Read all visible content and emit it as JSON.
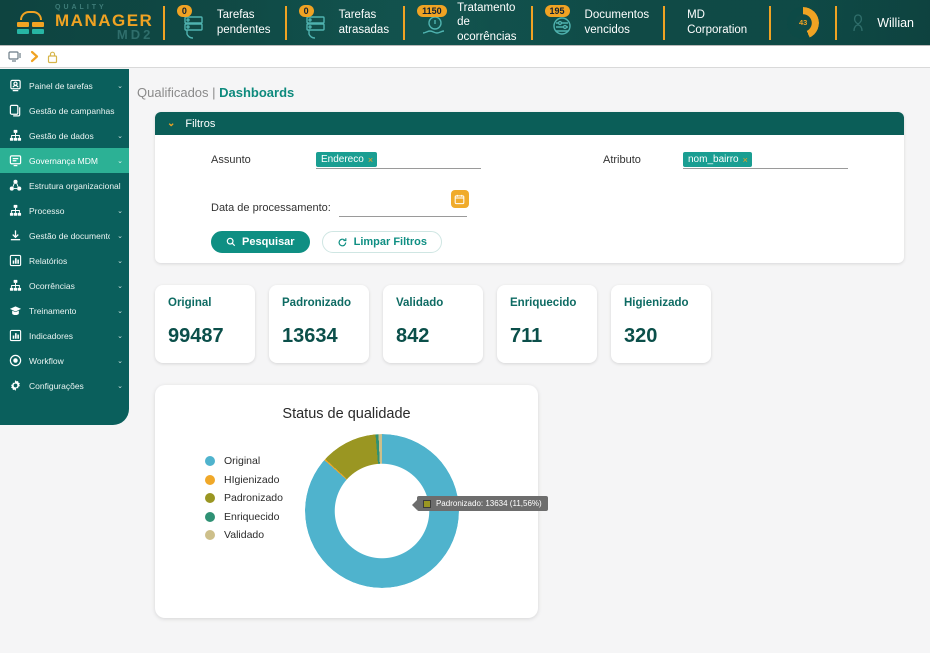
{
  "header": {
    "logo": {
      "top": "QUALITY",
      "mid": "MANAGER",
      "bottom": "MD2"
    },
    "items": [
      {
        "badge": "0",
        "label": "Tarefas\npendentes",
        "icon": "tasks-icon"
      },
      {
        "badge": "0",
        "label": "Tarefas\natrasadas",
        "icon": "late-tasks-icon"
      },
      {
        "badge": "1150",
        "label": "Tratamento de\nocorrências",
        "icon": "occurrences-icon"
      },
      {
        "badge": "195",
        "label": "Documentos\nvencidos",
        "icon": "expired-docs-icon"
      }
    ],
    "corporation": "MD\nCorporation",
    "gauge_value": "43",
    "user_name": "Willian"
  },
  "subbar": {
    "icons": [
      "monitor-icon",
      "chevron-right-icon",
      "lock-icon"
    ]
  },
  "sidebar": {
    "items": [
      {
        "label": "Painel de tarefas",
        "icon": "user-panel-icon",
        "chevron": true,
        "active": false
      },
      {
        "label": "Gestão de campanhas",
        "icon": "copy-icon",
        "chevron": false,
        "active": false
      },
      {
        "label": "Gestão de dados",
        "icon": "hierarchy-icon",
        "chevron": true,
        "active": false
      },
      {
        "label": "Governança MDM",
        "icon": "monitor-board-icon",
        "chevron": true,
        "active": true
      },
      {
        "label": "Estrutura organizacional",
        "icon": "org-structure-icon",
        "chevron": false,
        "active": false
      },
      {
        "label": "Processo",
        "icon": "process-icon",
        "chevron": true,
        "active": false
      },
      {
        "label": "Gestão de documentos",
        "icon": "download-doc-icon",
        "chevron": true,
        "active": false
      },
      {
        "label": "Relatórios",
        "icon": "bar-chart-icon",
        "chevron": true,
        "active": false
      },
      {
        "label": "Ocorrências",
        "icon": "hierarchy-icon",
        "chevron": true,
        "active": false
      },
      {
        "label": "Treinamento",
        "icon": "graduation-cap-icon",
        "chevron": true,
        "active": false
      },
      {
        "label": "Indicadores",
        "icon": "bar-chart-icon",
        "chevron": true,
        "active": false
      },
      {
        "label": "Workflow",
        "icon": "record-circle-icon",
        "chevron": true,
        "active": false
      },
      {
        "label": "Configurações",
        "icon": "gear-icon",
        "chevron": true,
        "active": false
      }
    ]
  },
  "breadcrumb": {
    "parent": "Qualificados | ",
    "current": "Dashboards"
  },
  "filters": {
    "title": "Filtros",
    "assunto_label": "Assunto",
    "assunto_chip": "Endereco",
    "atributo_label": "Atributo",
    "atributo_chip": "nom_bairro",
    "data_label": "Data de processamento:",
    "data_value": "",
    "data_placeholder": "",
    "search_button": "Pesquisar",
    "clear_button": "Limpar Filtros"
  },
  "kpis": [
    {
      "title": "Original",
      "value": "99487"
    },
    {
      "title": "Padronizado",
      "value": "13634"
    },
    {
      "title": "Validado",
      "value": "842"
    },
    {
      "title": "Enriquecido",
      "value": "711"
    },
    {
      "title": "Higienizado",
      "value": "320"
    }
  ],
  "chart_data": {
    "type": "pie",
    "title": "Status de qualidade",
    "legend_position": "left",
    "donut": true,
    "tooltip": "Padronizado: 13634 (11,56%)",
    "categories": [
      "Original",
      "HIgienizado",
      "Padronizado",
      "Enriquecido",
      "Validado"
    ],
    "values": [
      99487,
      320,
      13634,
      711,
      842
    ],
    "percents": [
      84.35,
      0.27,
      11.56,
      0.6,
      0.71
    ],
    "colors": [
      "#4fb3cd",
      "#f0a829",
      "#9a9622",
      "#2f9174",
      "#cdbf8a"
    ]
  }
}
